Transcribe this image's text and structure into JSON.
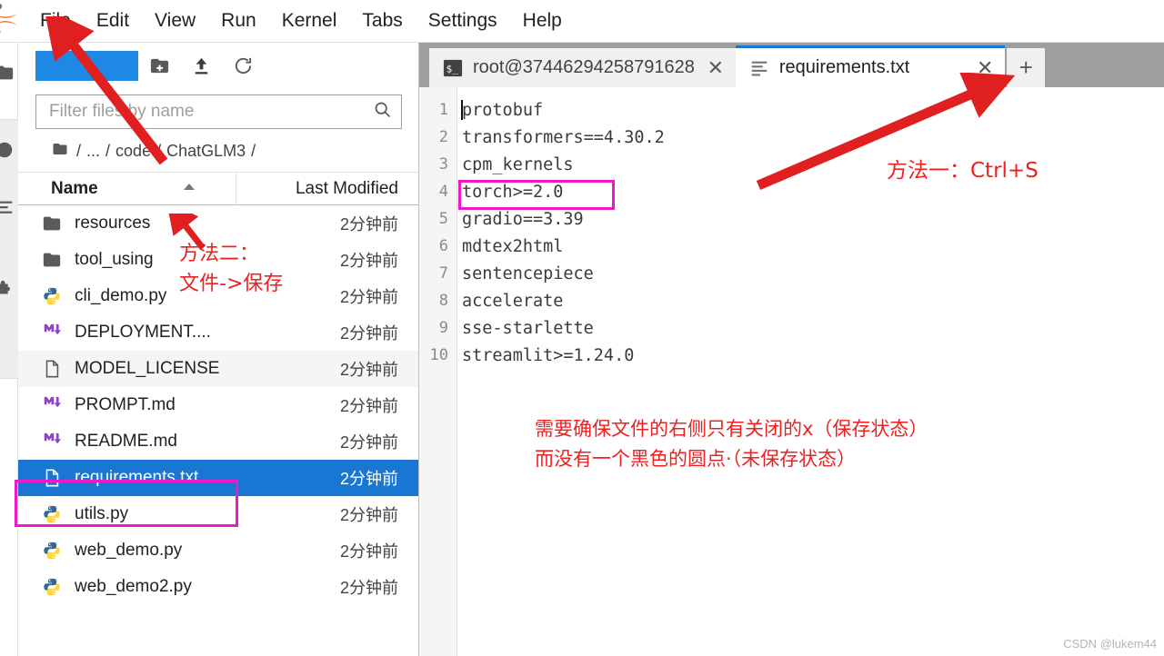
{
  "app": {
    "name": "JupyterLab",
    "logo_icon": "jupyter-logo-icon",
    "watermark": "CSDN @lukem44"
  },
  "menubar": {
    "items": [
      {
        "label": "File"
      },
      {
        "label": "Edit"
      },
      {
        "label": "View"
      },
      {
        "label": "Run"
      },
      {
        "label": "Kernel"
      },
      {
        "label": "Tabs"
      },
      {
        "label": "Settings"
      },
      {
        "label": "Help"
      }
    ]
  },
  "activitybar": {
    "items": [
      {
        "icon": "folder-icon",
        "name": "file-browser"
      },
      {
        "icon": "running-kernels-icon",
        "name": "running-terminals"
      },
      {
        "icon": "table-of-contents-icon",
        "name": "table-of-contents"
      },
      {
        "icon": "extension-puzzle-icon",
        "name": "extension-manager"
      }
    ]
  },
  "filebrowser": {
    "toolbar": {
      "new_launcher_label": "+",
      "new_folder_icon": "new-folder-icon",
      "upload_icon": "upload-icon",
      "refresh_icon": "refresh-icon"
    },
    "filter": {
      "placeholder": "Filter files by name",
      "value": "",
      "icon": "search-icon"
    },
    "breadcrumb": {
      "home_icon": "folder-icon",
      "parts": [
        "/",
        "...",
        "/",
        "code",
        "/",
        "ChatGLM3",
        "/"
      ]
    },
    "columns": {
      "name": "Name",
      "last_modified": "Last Modified"
    },
    "rows": [
      {
        "name": "resources",
        "modified": "2分钟前",
        "icon": "folder-icon",
        "selected": false,
        "alt": false
      },
      {
        "name": "tool_using",
        "modified": "2分钟前",
        "icon": "folder-icon",
        "selected": false,
        "alt": false
      },
      {
        "name": "cli_demo.py",
        "modified": "2分钟前",
        "icon": "python-icon",
        "selected": false,
        "alt": false
      },
      {
        "name": "DEPLOYMENT....",
        "modified": "2分钟前",
        "icon": "markdown-icon",
        "selected": false,
        "alt": false
      },
      {
        "name": "MODEL_LICENSE",
        "modified": "2分钟前",
        "icon": "file-icon",
        "selected": false,
        "alt": true
      },
      {
        "name": "PROMPT.md",
        "modified": "2分钟前",
        "icon": "markdown-icon",
        "selected": false,
        "alt": false
      },
      {
        "name": "README.md",
        "modified": "2分钟前",
        "icon": "markdown-icon",
        "selected": false,
        "alt": false
      },
      {
        "name": "requirements.txt",
        "modified": "2分钟前",
        "icon": "file-icon",
        "selected": true,
        "alt": false
      },
      {
        "name": "utils.py",
        "modified": "2分钟前",
        "icon": "python-icon",
        "selected": false,
        "alt": false
      },
      {
        "name": "web_demo.py",
        "modified": "2分钟前",
        "icon": "python-icon",
        "selected": false,
        "alt": false
      },
      {
        "name": "web_demo2.py",
        "modified": "2分钟前",
        "icon": "python-icon",
        "selected": false,
        "alt": false
      }
    ]
  },
  "main": {
    "tabs": [
      {
        "label": "root@37446294258791628",
        "icon": "terminal-icon",
        "active": false,
        "close_icon": "close-icon"
      },
      {
        "label": "requirements.txt",
        "icon": "text-editor-icon",
        "active": true,
        "close_icon": "close-icon"
      }
    ],
    "add_tab_label": "+",
    "editor": {
      "filename": "requirements.txt",
      "lines": [
        {
          "number": "1",
          "text": "protobuf"
        },
        {
          "number": "2",
          "text": "transformers==4.30.2"
        },
        {
          "number": "3",
          "text": "cpm_kernels"
        },
        {
          "number": "4",
          "text": "torch>=2.0"
        },
        {
          "number": "5",
          "text": "gradio==3.39"
        },
        {
          "number": "6",
          "text": "mdtex2html"
        },
        {
          "number": "7",
          "text": "sentencepiece"
        },
        {
          "number": "8",
          "text": "accelerate"
        },
        {
          "number": "9",
          "text": "sse-starlette"
        },
        {
          "number": "10",
          "text": "streamlit>=1.24.0"
        }
      ]
    }
  },
  "annotations": {
    "method_one": "方法一：Ctrl+S",
    "method_two_line1": "方法二：",
    "method_two_line2": "文件->保存",
    "note_line1": "需要确保文件的右侧只有关闭的x（保存状态）",
    "note_line2": "而没有一个黑色的圆点·（未保存状态）",
    "colors": {
      "arrow_red": "#e02020",
      "text_red": "#ef2020",
      "highlight_magenta": "#ef19c8",
      "selection_blue": "#1976d2",
      "accent_blue": "#1e88e5"
    }
  }
}
